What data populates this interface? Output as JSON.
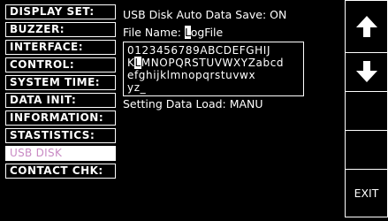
{
  "menu": {
    "items": [
      {
        "label": "DISPLAY SET:"
      },
      {
        "label": "BUZZER:"
      },
      {
        "label": "INTERFACE:"
      },
      {
        "label": "CONTROL:"
      },
      {
        "label": "SYSTEM TIME:"
      },
      {
        "label": "DATA INIT:"
      },
      {
        "label": "INFORMATION:"
      },
      {
        "label": "STASTISTICS:"
      },
      {
        "label": "USB DISK"
      },
      {
        "label": "CONTACT CHK:"
      }
    ],
    "active_index": 8
  },
  "main": {
    "auto_save": "USB Disk Auto Data Save: ON",
    "file_name_label": "File Name: ",
    "file_name_cursor": "L",
    "file_name_rest": "ogFile",
    "charset": {
      "row1": "0123456789ABCDEFGHIJ",
      "row2_pre": "K",
      "row2_cursor": "L",
      "row2_post": "MNOPQRSTUVWXYZabcd",
      "row3": "efghijklmnopqrstuvwx",
      "row4": "yz_"
    },
    "setting_data_load": "Setting Data Load: MANU"
  },
  "buttons": {
    "up_icon": "arrow-up-icon",
    "down_icon": "arrow-down-icon",
    "exit_label": "EXIT"
  },
  "colors": {
    "background": "#000000",
    "foreground": "#ffffff",
    "active_menu_text": "#c98ac4"
  }
}
